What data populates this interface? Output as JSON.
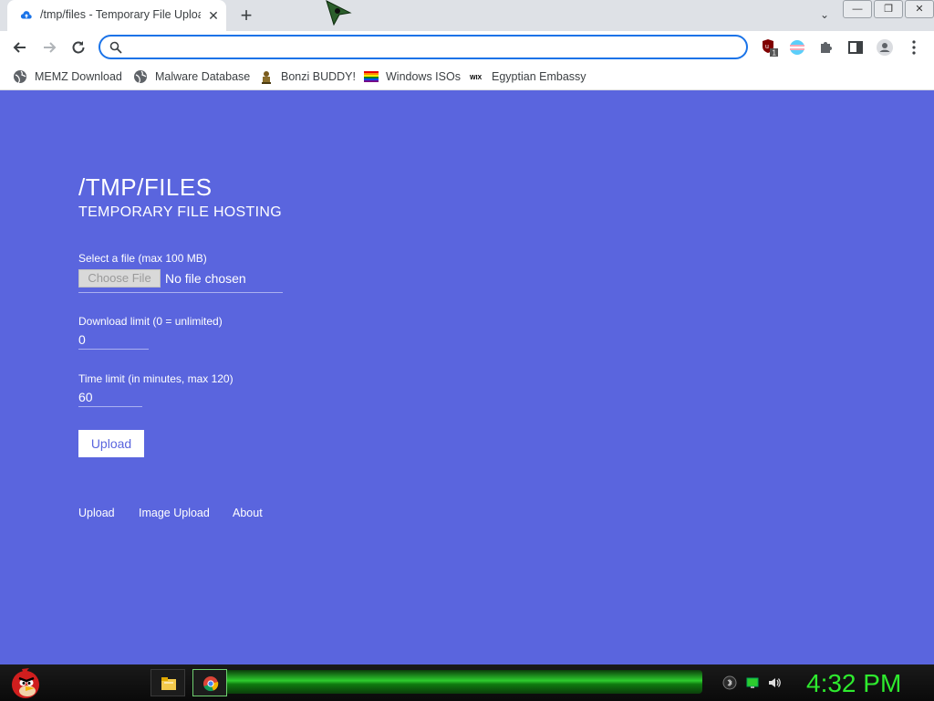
{
  "tab": {
    "title": "/tmp/files - Temporary File Upload",
    "close": "✕"
  },
  "newtab": "+",
  "window_controls": {
    "minimize": "—",
    "restore": "❐",
    "close": "✕"
  },
  "omnibox": {
    "value": "",
    "placeholder": ""
  },
  "bookmarks": [
    {
      "label": "MEMZ Download",
      "icon": "globe-icon"
    },
    {
      "label": "Malware Database",
      "icon": "globe-icon"
    },
    {
      "label": "Bonzi BUDDY!",
      "icon": "bonzi-icon"
    },
    {
      "label": "Windows ISOs",
      "icon": "rainbow-flag-icon"
    },
    {
      "label": "Egyptian Embassy",
      "icon": "wix-icon"
    }
  ],
  "page": {
    "title": "/TMP/FILES",
    "subtitle": "TEMPORARY FILE HOSTING",
    "file_label": "Select a file (max 100 MB)",
    "choose_file": "Choose File",
    "no_file": "No file chosen",
    "download_label": "Download limit (0 = unlimited)",
    "download_value": "0",
    "time_label": "Time limit (in minutes, max 120)",
    "time_value": "60",
    "upload_button": "Upload",
    "footer": [
      "Upload",
      "Image Upload",
      "About"
    ]
  },
  "ext_badge": "1",
  "clock": "4:32 PM",
  "colors": {
    "page_bg": "#5a65de",
    "omnibox_border": "#1a73e8",
    "clock": "#2eea2e"
  }
}
